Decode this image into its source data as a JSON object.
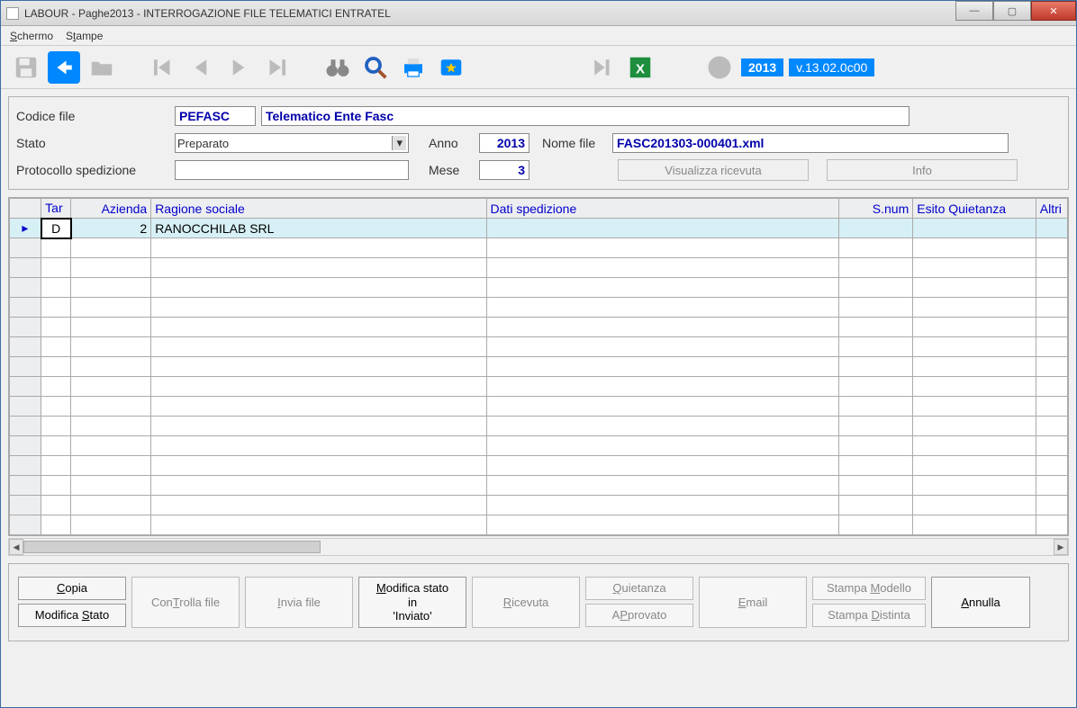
{
  "window": {
    "title": "LABOUR - Paghe2013 - INTERROGAZIONE FILE TELEMATICI ENTRATEL"
  },
  "menubar": {
    "schermo": "Schermo",
    "stampe": "Stampe"
  },
  "toolbar": {
    "year": "2013",
    "version": "v.13.02.0c00"
  },
  "form": {
    "codice_file_label": "Codice file",
    "codice_file_value": "PEFASC",
    "codice_file_desc": "Telematico Ente Fasc",
    "stato_label": "Stato",
    "stato_value": "Preparato",
    "anno_label": "Anno",
    "anno_value": "2013",
    "nome_file_label": "Nome file",
    "nome_file_value": "FASC201303-000401.xml",
    "protocollo_label": "Protocollo spedizione",
    "protocollo_value": "",
    "mese_label": "Mese",
    "mese_value": "3",
    "visualizza_btn": "Visualizza ricevuta",
    "info_btn": "Info"
  },
  "grid": {
    "headers": {
      "tar": "Tar",
      "azienda": "Azienda",
      "ragione": "Ragione sociale",
      "dati": "Dati spedizione",
      "snum": "S.num",
      "esito": "Esito Quietanza",
      "altri": "Altri"
    },
    "rows": [
      {
        "marker": "▸",
        "tar": "D",
        "azienda": "2",
        "ragione": "RANOCCHILAB SRL",
        "dati": "",
        "snum": "",
        "esito": "",
        "altri": ""
      }
    ]
  },
  "bottom": {
    "copia": "Copia",
    "modifica_stato": "Modifica Stato",
    "controlla": "ConTrolla file",
    "invia": "Invia file",
    "modifica_inviato_l1": "Modifica stato",
    "modifica_inviato_l2": "in",
    "modifica_inviato_l3": "'Inviato'",
    "ricevuta": "Ricevuta",
    "quietanza": "Quietanza",
    "approvato": "APprovato",
    "email": "Email",
    "stampa_modello": "Stampa Modello",
    "stampa_distinta": "Stampa Distinta",
    "annulla": "Annulla"
  }
}
